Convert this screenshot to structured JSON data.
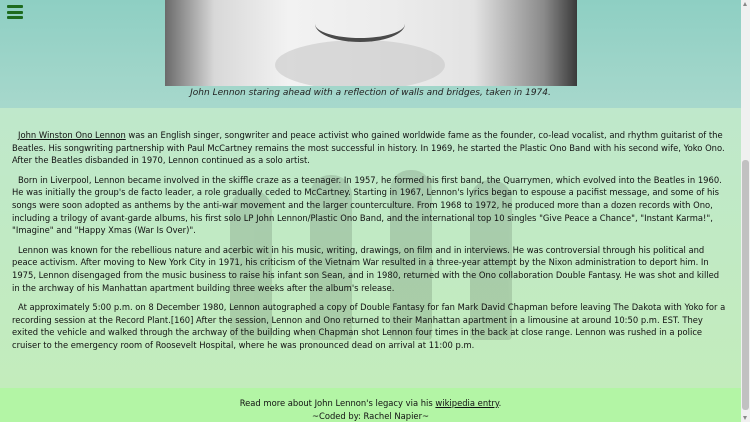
{
  "caption": "John Lennon staring ahead with a reflection of walls and bridges, taken in 1974.",
  "bio": {
    "p1_link": "John Winston Ono Lennon",
    "p1_rest": " was an English singer, songwriter and peace activist who gained worldwide fame as the founder, co-lead vocalist, and rhythm guitarist of the Beatles. His songwriting partnership with Paul McCartney remains the most successful in history. In 1969, he started the Plastic Ono Band with his second wife, Yoko Ono. After the Beatles disbanded in 1970, Lennon continued as a solo artist.",
    "p2": "Born in Liverpool, Lennon became involved in the skiffle craze as a teenager. In 1957, he formed his first band, the Quarrymen, which evolved into the Beatles in 1960. He was initially the group's de facto leader, a role gradually ceded to McCartney. Starting in 1967, Lennon's lyrics began to espouse a pacifist message, and some of his songs were soon adopted as anthems by the anti-war movement and the larger counterculture. From 1968 to 1972, he produced more than a dozen records with Ono, including a trilogy of avant-garde albums, his first solo LP John Lennon/Plastic Ono Band, and the international top 10 singles \"Give Peace a Chance\", \"Instant Karma!\", \"Imagine\" and \"Happy Xmas (War Is Over)\".",
    "p3": "Lennon was known for the rebellious nature and acerbic wit in his music, writing, drawings, on film and in interviews. He was controversial through his political and peace activism. After moving to New York City in 1971, his criticism of the Vietnam War resulted in a three-year attempt by the Nixon administration to deport him. In 1975, Lennon disengaged from the music business to raise his infant son Sean, and in 1980, returned with the Ono collaboration Double Fantasy. He was shot and killed in the archway of his Manhattan apartment building three weeks after the album's release.",
    "p4": "At approximately 5:00 p.m. on 8 December 1980, Lennon autographed a copy of Double Fantasy for fan Mark David Chapman before leaving The Dakota with Yoko for a recording session at the Record Plant.[160] After the session, Lennon and Ono returned to their Manhattan apartment in a limousine at around 10:50 p.m. EST. They exited the vehicle and walked through the archway of the building when Chapman shot Lennon four times in the back at close range. Lennon was rushed in a police cruiser to the emergency room of Roosevelt Hospital, where he was pronounced dead on arrival at 11:00 p.m."
  },
  "footer": {
    "read_more_before": "Read more about John Lennon's legacy via his ",
    "wiki_link": "wikipedia entry",
    "read_more_after": ".",
    "credit": "~Coded by: Rachel Napier~"
  },
  "icons": {
    "menu": "hamburger-menu-icon"
  },
  "colors": {
    "footer_bg": "#b3f5a5",
    "menu_icon": "#1e6b1e"
  }
}
